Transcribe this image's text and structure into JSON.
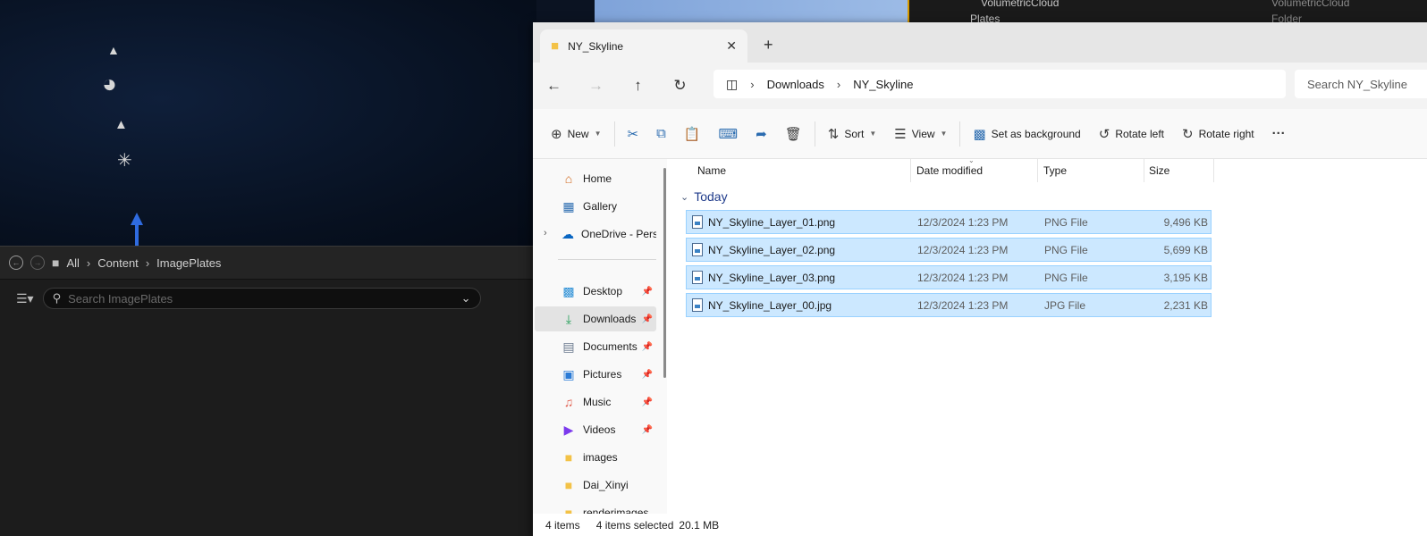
{
  "outliner": {
    "rows": [
      {
        "name": "VolumetricCloud",
        "type": "VolumetricCloud"
      },
      {
        "name": "Plates",
        "type": "Folder"
      }
    ]
  },
  "content_browser": {
    "breadcrumb": [
      "All",
      "Content",
      "ImagePlates"
    ],
    "search_placeholder": "Search ImagePlates"
  },
  "explorer": {
    "tab_title": "NY_Skyline",
    "new_tab": "+",
    "address": [
      "Downloads",
      "NY_Skyline"
    ],
    "search_placeholder": "Search NY_Skyline",
    "toolbar": {
      "new": "New",
      "sort": "Sort",
      "view": "View",
      "set_background": "Set as background",
      "rotate_left": "Rotate left",
      "rotate_right": "Rotate right",
      "more": "···"
    },
    "nav": [
      {
        "label": "Home",
        "icon": "home-icon",
        "pinned": false
      },
      {
        "label": "Gallery",
        "icon": "gallery-icon",
        "pinned": false
      },
      {
        "label": "OneDrive - Perso",
        "icon": "onedrive-icon",
        "pinned": false
      },
      {
        "label": "Desktop",
        "icon": "desktop-icon",
        "pinned": true
      },
      {
        "label": "Downloads",
        "icon": "downloads-icon",
        "pinned": true
      },
      {
        "label": "Documents",
        "icon": "documents-icon",
        "pinned": true
      },
      {
        "label": "Pictures",
        "icon": "pictures-icon",
        "pinned": true
      },
      {
        "label": "Music",
        "icon": "music-icon",
        "pinned": true
      },
      {
        "label": "Videos",
        "icon": "videos-icon",
        "pinned": true
      },
      {
        "label": "images",
        "icon": "folder-icon",
        "pinned": false
      },
      {
        "label": "Dai_Xinyi",
        "icon": "folder-icon",
        "pinned": false
      },
      {
        "label": "renderimages",
        "icon": "folder-icon",
        "pinned": false
      }
    ],
    "columns": {
      "name": "Name",
      "date": "Date modified",
      "type": "Type",
      "size": "Size"
    },
    "group": "Today",
    "files": [
      {
        "name": "NY_Skyline_Layer_01.png",
        "date": "12/3/2024 1:23 PM",
        "type": "PNG File",
        "size": "9,496 KB"
      },
      {
        "name": "NY_Skyline_Layer_02.png",
        "date": "12/3/2024 1:23 PM",
        "type": "PNG File",
        "size": "5,699 KB"
      },
      {
        "name": "NY_Skyline_Layer_03.png",
        "date": "12/3/2024 1:23 PM",
        "type": "PNG File",
        "size": "3,195 KB"
      },
      {
        "name": "NY_Skyline_Layer_00.jpg",
        "date": "12/3/2024 1:23 PM",
        "type": "JPG File",
        "size": "2,231 KB"
      }
    ],
    "status": {
      "items": "4 items",
      "selected": "4 items selected",
      "size": "20.1 MB"
    }
  },
  "colors": {
    "accent": "#0067c0",
    "selection": "#cce8ff",
    "folder": "#f3c247",
    "ue_border": "#d79b00"
  }
}
